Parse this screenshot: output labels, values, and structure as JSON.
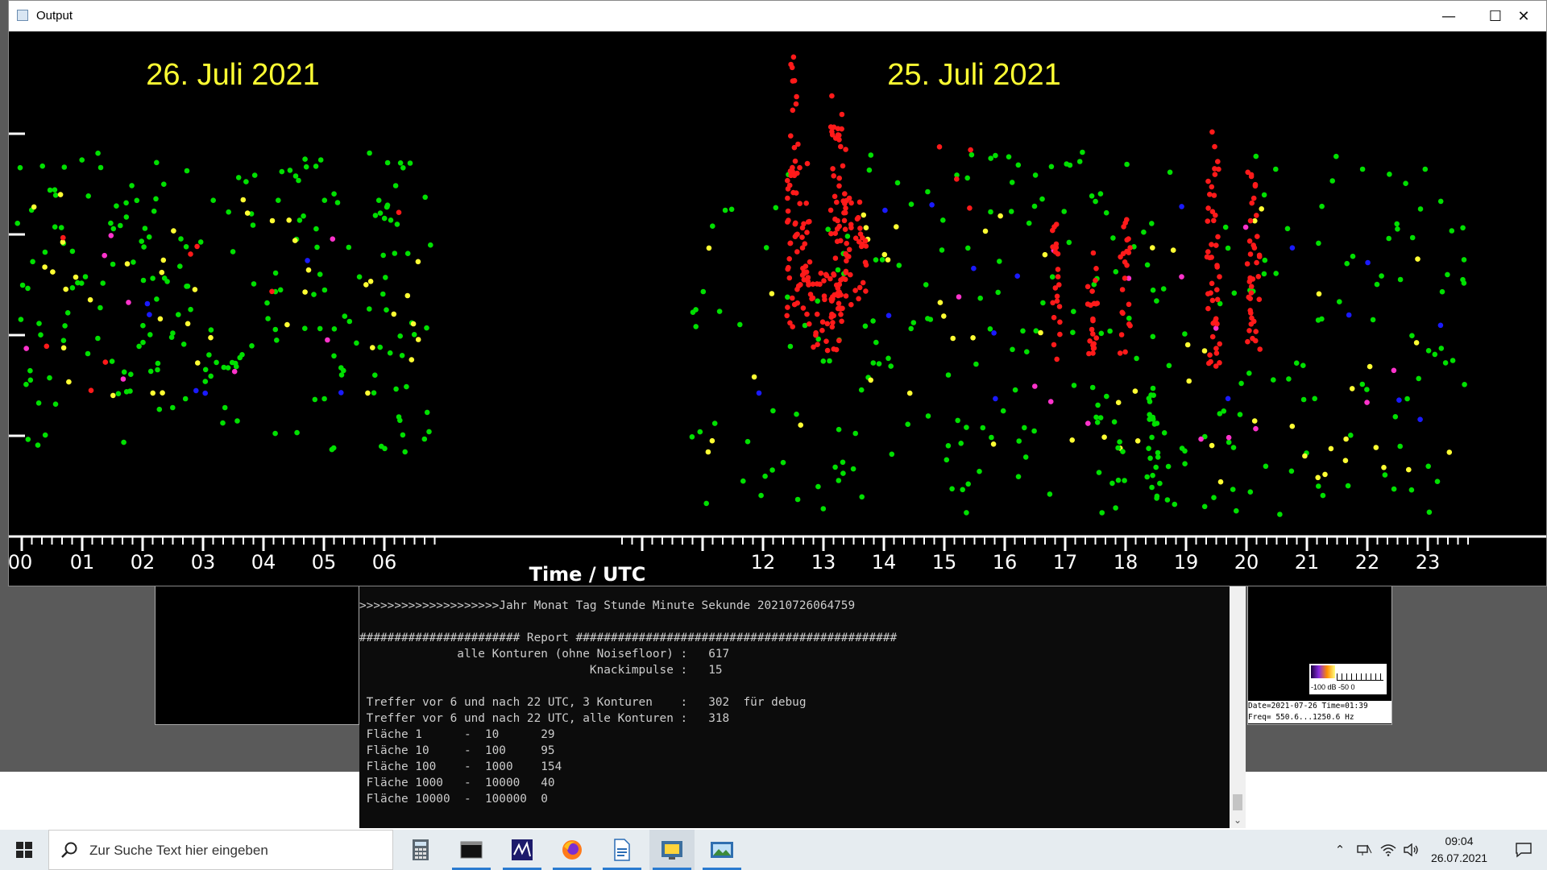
{
  "window": {
    "title": "Output",
    "minimize_label": "—",
    "maximize_label": "☐",
    "close_label": "✕"
  },
  "plot": {
    "date_left": "26. Juli 2021",
    "date_right": "25. Juli 2021",
    "axis_title": "Time / UTC",
    "hour_labels_left": [
      "00",
      "01",
      "02",
      "03",
      "04",
      "05",
      "06"
    ],
    "hour_labels_right": [
      "12",
      "13",
      "14",
      "15",
      "16",
      "17",
      "18",
      "19",
      "20",
      "21",
      "22",
      "23"
    ],
    "colors": {
      "green": "#00e000",
      "yellow": "#ffff33",
      "red": "#ff1a1a",
      "blue": "#1a1aff",
      "magenta": "#ff33cc",
      "title_yellow": "#ffff33"
    }
  },
  "console": {
    "line1": ">>>>>>>>>>>>>>>>>>>>Jahr Monat Tag Stunde Minute Sekunde 20210726064759",
    "line2": "",
    "line3": "####################### Report ##############################################",
    "line4": "              alle Konturen (ohne Noisefloor) :   617",
    "line5": "                                 Knackimpulse :   15",
    "line6": "",
    "line7": " Treffer vor 6 und nach 22 UTC, 3 Konturen    :   302  für debug",
    "line8": " Treffer vor 6 und nach 22 UTC, alle Konturen :   318",
    "line9": " Fläche 1      -  10      29",
    "line10": " Fläche 10     -  100     95",
    "line11": " Fläche 100    -  1000    154",
    "line12": " Fläche 1000   -  10000   40",
    "line13": " Fläche 10000  -  100000  0"
  },
  "spectro_info": {
    "colorbar_label": "-100 dB  -50    0",
    "date_line": "Date=2021-07-26 Time=01:39",
    "freq_line": "Freq= 550.6...1250.6 Hz"
  },
  "taskbar": {
    "search_placeholder": "Zur Suche Text hier eingeben",
    "time": "09:04",
    "date": "26.07.2021"
  }
}
